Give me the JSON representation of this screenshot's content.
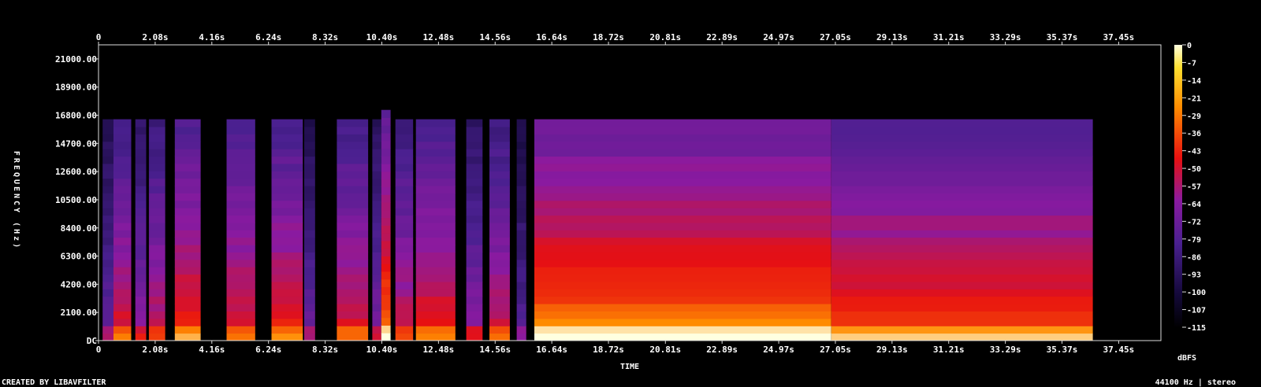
{
  "chart_data": {
    "type": "heatmap",
    "title": "",
    "xlabel": "TIME",
    "ylabel": "FREQUENCY (Hz)",
    "x_ticks": [
      "0",
      "2.08s",
      "4.16s",
      "6.24s",
      "8.32s",
      "10.40s",
      "12.48s",
      "14.56s",
      "16.64s",
      "18.72s",
      "20.81s",
      "22.89s",
      "24.97s",
      "27.05s",
      "29.13s",
      "31.21s",
      "33.29s",
      "35.37s",
      "37.45s"
    ],
    "x_tick_values": [
      0,
      2.08,
      4.16,
      6.24,
      8.32,
      10.4,
      12.48,
      14.56,
      16.64,
      18.72,
      20.81,
      22.89,
      24.97,
      27.05,
      29.13,
      31.21,
      33.29,
      35.37,
      37.45
    ],
    "xlim": [
      0,
      39.0
    ],
    "y_ticks": [
      "DC",
      "2100.00",
      "4200.00",
      "6300.00",
      "8400.00",
      "10500.00",
      "12600.00",
      "14700.00",
      "16800.00",
      "18900.00",
      "21000.00"
    ],
    "y_tick_values": [
      0,
      2100,
      4200,
      6300,
      8400,
      10500,
      12600,
      14700,
      16800,
      18900,
      21000
    ],
    "ylim": [
      0,
      22050
    ],
    "colorbar": {
      "label": "dBFS",
      "ticks": [
        "0",
        "-7",
        "-14",
        "-21",
        "-29",
        "-36",
        "-43",
        "-50",
        "-57",
        "-64",
        "-72",
        "-79",
        "-86",
        "-93",
        "-100",
        "-107",
        "-115"
      ],
      "tick_values": [
        0,
        -7,
        -14,
        -21,
        -29,
        -36,
        -43,
        -50,
        -57,
        -64,
        -72,
        -79,
        -86,
        "-93",
        -100,
        -107,
        -115
      ],
      "range": [
        -120,
        0
      ]
    },
    "colors": {
      "low": "#000000",
      "dark": "#14093a",
      "mid_low": "#4a2090",
      "mid": "#8a1aa0",
      "mid_high": "#e81010",
      "high": "#ff8c00",
      "top": "#ffffe0"
    },
    "segments": [
      {
        "start": 0.15,
        "end": 0.55,
        "level": 0.45,
        "fmax": 16500
      },
      {
        "start": 0.55,
        "end": 1.2,
        "level": 0.7,
        "fmax": 16500
      },
      {
        "start": 1.35,
        "end": 1.75,
        "level": 0.55,
        "fmax": 16500
      },
      {
        "start": 1.85,
        "end": 2.45,
        "level": 0.65,
        "fmax": 16500
      },
      {
        "start": 2.8,
        "end": 3.75,
        "level": 0.78,
        "fmax": 16500
      },
      {
        "start": 4.7,
        "end": 5.75,
        "level": 0.72,
        "fmax": 16500
      },
      {
        "start": 6.35,
        "end": 7.5,
        "level": 0.74,
        "fmax": 16500
      },
      {
        "start": 7.55,
        "end": 7.95,
        "level": 0.45,
        "fmax": 16500
      },
      {
        "start": 8.75,
        "end": 9.9,
        "level": 0.7,
        "fmax": 16500
      },
      {
        "start": 10.05,
        "end": 10.38,
        "level": 0.5,
        "fmax": 16500
      },
      {
        "start": 10.38,
        "end": 10.72,
        "level": 0.88,
        "fmax": 17200
      },
      {
        "start": 10.9,
        "end": 11.55,
        "level": 0.66,
        "fmax": 16500
      },
      {
        "start": 11.65,
        "end": 13.1,
        "level": 0.74,
        "fmax": 16500
      },
      {
        "start": 13.5,
        "end": 14.1,
        "level": 0.55,
        "fmax": 16500
      },
      {
        "start": 14.35,
        "end": 15.1,
        "level": 0.66,
        "fmax": 16500
      },
      {
        "start": 15.35,
        "end": 15.7,
        "level": 0.4,
        "fmax": 16500
      },
      {
        "start": 16.0,
        "end": 26.9,
        "level": 0.9,
        "fmax": 16500
      },
      {
        "start": 26.9,
        "end": 36.5,
        "level": 0.8,
        "fmax": 16500
      }
    ]
  },
  "footer": {
    "left": "CREATED BY LIBAVFILTER",
    "right": "44100 Hz | stereo"
  }
}
